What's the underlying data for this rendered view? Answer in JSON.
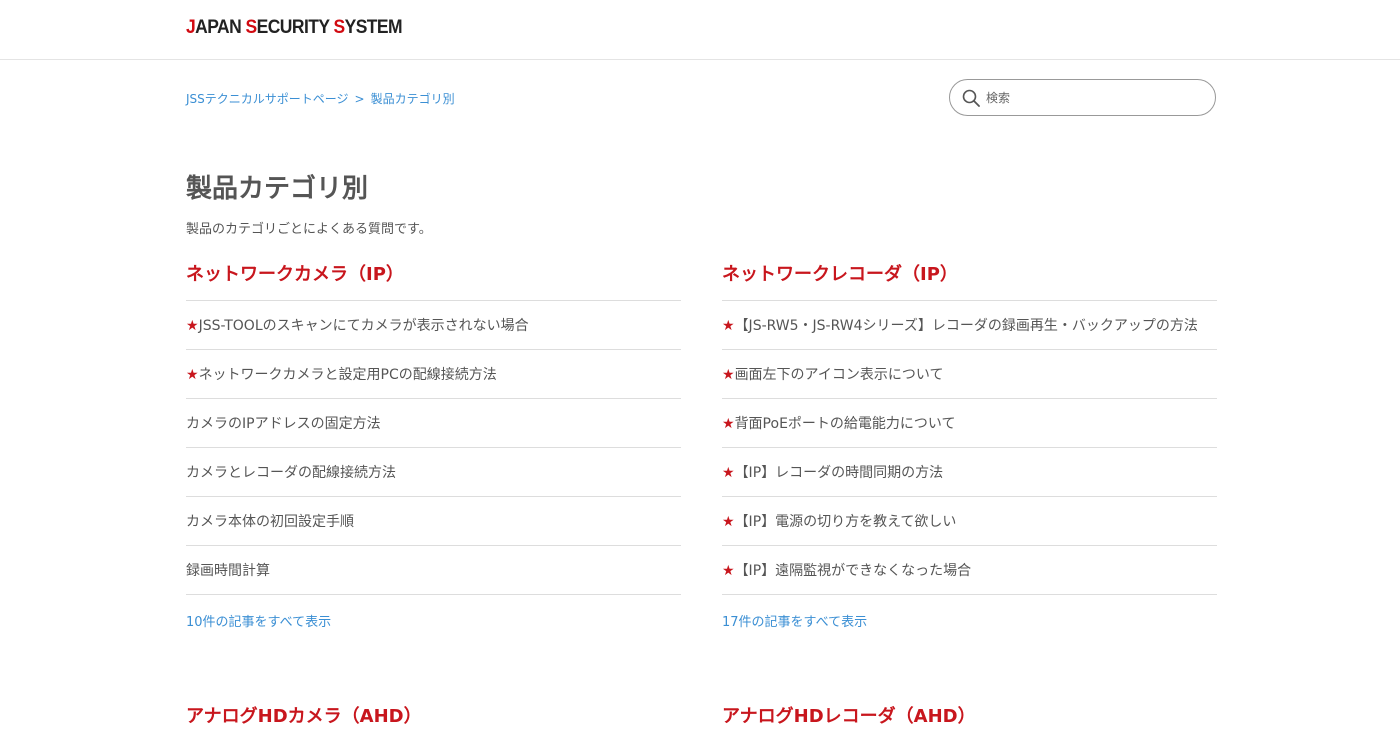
{
  "header": {
    "logo": {
      "parts": [
        {
          "text": "J",
          "accent": true
        },
        {
          "text": "APAN ",
          "accent": false
        },
        {
          "text": "S",
          "accent": true
        },
        {
          "text": "ECURITY ",
          "accent": false
        },
        {
          "text": "S",
          "accent": true
        },
        {
          "text": "YSTEM",
          "accent": false
        }
      ],
      "accent_color": "#d10a11"
    }
  },
  "breadcrumb": {
    "items": [
      "JSSテクニカルサポートページ",
      "製品カテゴリ別"
    ],
    "separator": ">"
  },
  "search": {
    "icon": "search-icon",
    "placeholder": "検索",
    "value": ""
  },
  "main": {
    "title": "製品カテゴリ別",
    "description": "製品のカテゴリごとによくある質問です。"
  },
  "sections": [
    {
      "title": "ネットワークカメラ（IP）",
      "articles": [
        "★JSS-TOOLのスキャンにてカメラが表示されない場合",
        "★ネットワークカメラと設定用PCの配線接続方法",
        "カメラのIPアドレスの固定方法",
        "カメラとレコーダの配線接続方法",
        "カメラ本体の初回設定手順",
        "録画時間計算"
      ],
      "see_all": "10件の記事をすべて表示"
    },
    {
      "title": "ネットワークレコーダ（IP）",
      "articles": [
        "★【JS-RW5・JS-RW4シリーズ】レコーダの録画再生・バックアップの方法",
        "★画面左下のアイコン表示について",
        "★背面PoEポートの給電能力について",
        "★【IP】レコーダの時間同期の方法",
        "★【IP】電源の切り方を教えて欲しい",
        "★【IP】遠隔監視ができなくなった場合"
      ],
      "see_all": "17件の記事をすべて表示"
    },
    {
      "title": "アナログHDカメラ（AHD）"
    },
    {
      "title": "アナログHDレコーダ（AHD）"
    }
  ],
  "colors": {
    "section_title": "#c8161d",
    "link": "#3b8fd4",
    "text": "#555555",
    "star": "#c8161d"
  }
}
